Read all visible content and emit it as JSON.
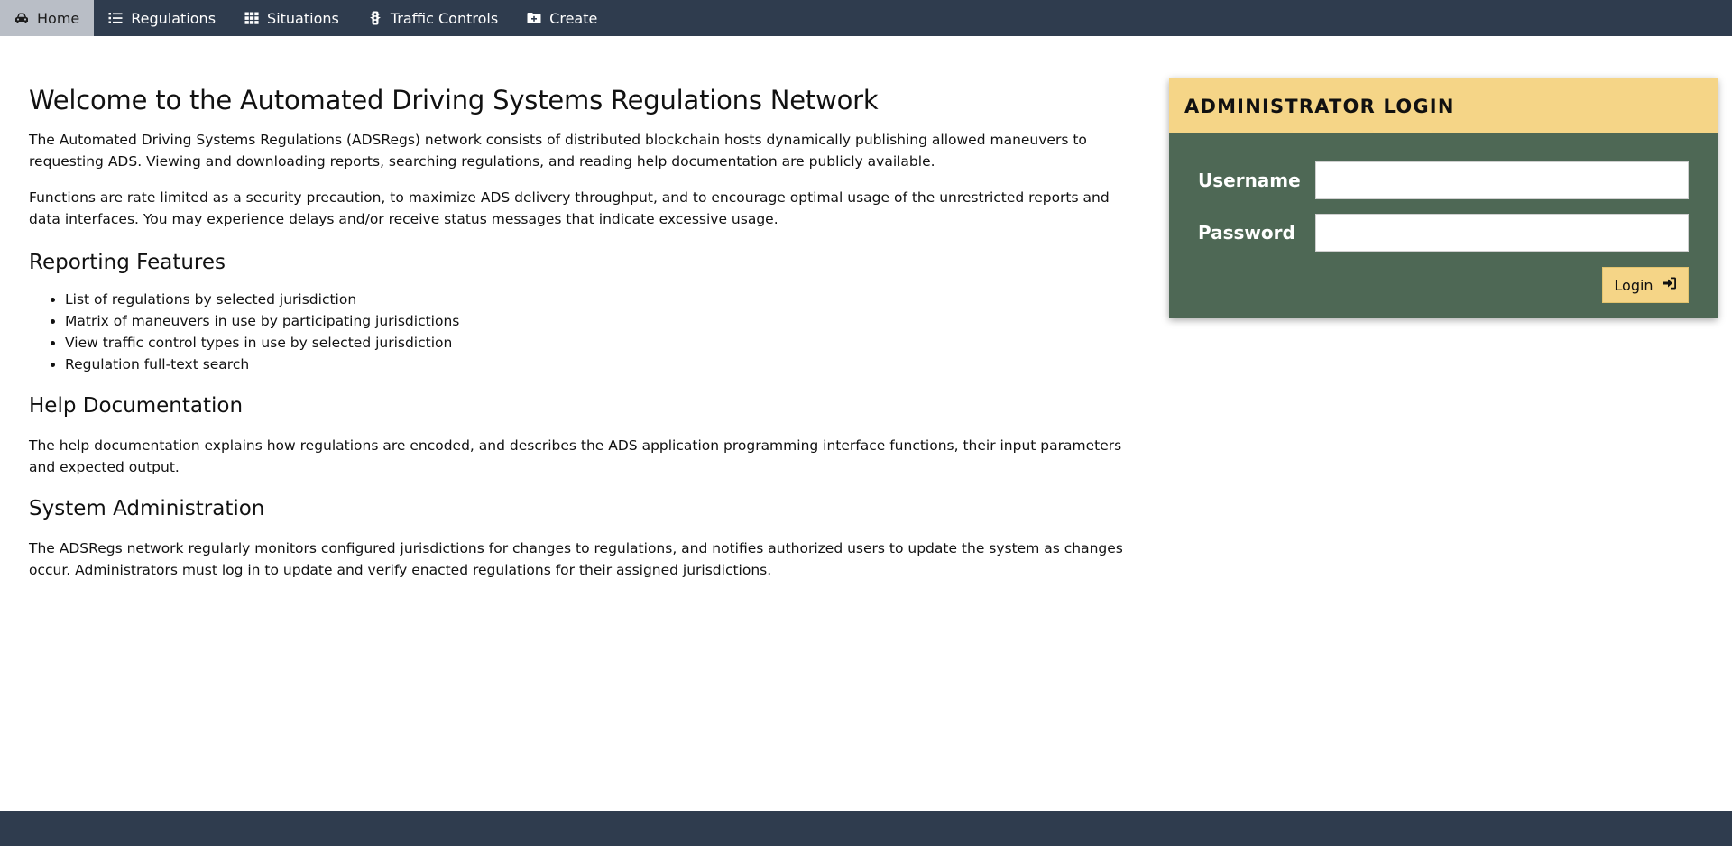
{
  "nav": {
    "items": [
      {
        "label": "Home",
        "icon": "car-icon",
        "active": true
      },
      {
        "label": "Regulations",
        "icon": "list-icon",
        "active": false
      },
      {
        "label": "Situations",
        "icon": "grid-icon",
        "active": false
      },
      {
        "label": "Traffic Controls",
        "icon": "traffic-light-icon",
        "active": false
      },
      {
        "label": "Create",
        "icon": "folder-plus-icon",
        "active": false
      }
    ]
  },
  "main": {
    "title": "Welcome to the Automated Driving Systems Regulations Network",
    "intro1": "The Automated Driving Systems Regulations (ADSRegs) network consists of distributed blockchain hosts dynamically publishing allowed maneuvers to requesting ADS. Viewing and downloading reports, searching regulations, and reading help documentation are publicly available.",
    "intro2": "Functions are rate limited as a security precaution, to maximize ADS delivery throughput, and to encourage optimal usage of the unrestricted reports and data interfaces. You may experience delays and/or receive status messages that indicate excessive usage.",
    "reporting": {
      "heading": "Reporting Features",
      "items": [
        "List of regulations by selected jurisdiction",
        "Matrix of maneuvers in use by participating jurisdictions",
        "View traffic control types in use by selected jurisdiction",
        "Regulation full-text search"
      ]
    },
    "help": {
      "heading": "Help Documentation",
      "text": "The help documentation explains how regulations are encoded, and describes the ADS application programming interface functions, their input parameters and expected output."
    },
    "admin": {
      "heading": "System Administration",
      "text": "The ADSRegs network regularly monitors configured jurisdictions for changes to regulations, and notifies authorized users to update the system as changes occur. Administrators must log in to update and verify enacted regulations for their assigned jurisdictions."
    }
  },
  "login": {
    "title": "ADMINISTRATOR LOGIN",
    "username_label": "Username",
    "username_value": "",
    "password_label": "Password",
    "password_value": "",
    "button_label": "Login"
  },
  "colors": {
    "navbar": "#2f3c4e",
    "nav_active": "#b9bec6",
    "login_header": "#f5d587",
    "login_body": "#4e6855",
    "footer": "#2f3c4e"
  }
}
